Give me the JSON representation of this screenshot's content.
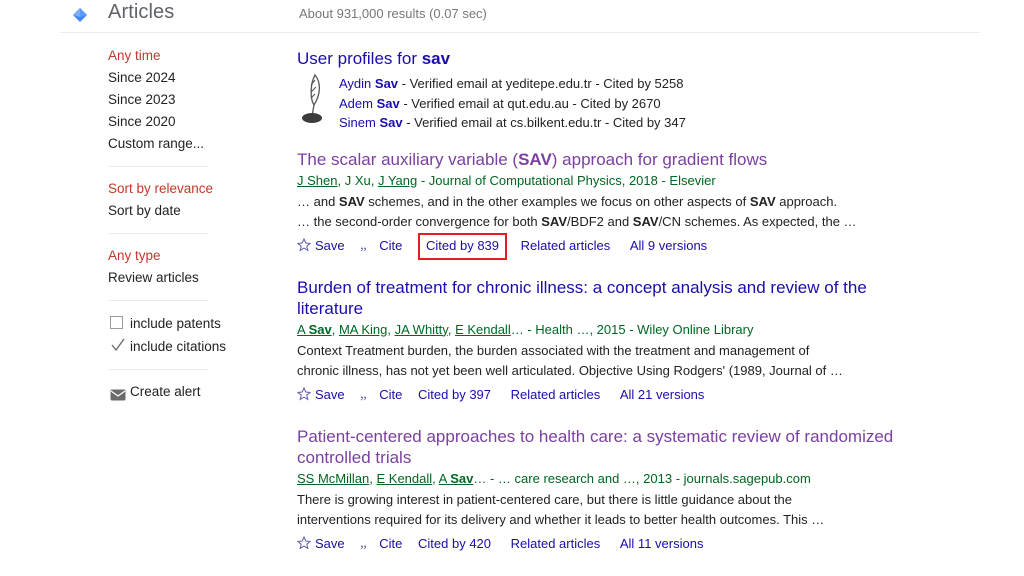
{
  "topbar": {
    "logo_icon": "scholar-diamond-icon",
    "title": "Articles",
    "results_count": "About 931,000 results (0.07 sec)"
  },
  "sidebar": {
    "time_filters": [
      {
        "label": "Any time",
        "selected": true
      },
      {
        "label": "Since 2024",
        "selected": false
      },
      {
        "label": "Since 2023",
        "selected": false
      },
      {
        "label": "Since 2020",
        "selected": false
      },
      {
        "label": "Custom range...",
        "selected": false
      }
    ],
    "sort_filters": [
      {
        "label": "Sort by relevance",
        "selected": true
      },
      {
        "label": "Sort by date",
        "selected": false
      }
    ],
    "type_filters": [
      {
        "label": "Any type",
        "selected": true
      },
      {
        "label": "Review articles",
        "selected": false
      }
    ],
    "checkboxes": [
      {
        "label": "include patents",
        "checked": false,
        "icon": "checkbox-empty-icon"
      },
      {
        "label": "include citations",
        "checked": true,
        "icon": "checkbox-checked-icon"
      }
    ],
    "alert": {
      "label": "Create alert",
      "icon": "envelope-icon"
    }
  },
  "profiles": {
    "heading_prefix": "User profiles for ",
    "heading_query": "sav",
    "icon": "quill-pen-icon",
    "entries": [
      {
        "first_name": "Aydin ",
        "last_name": "Sav",
        "detail": " - Verified email at yeditepe.edu.tr - Cited by 5258"
      },
      {
        "first_name": "Adem ",
        "last_name": "Sav",
        "detail": " - Verified email at qut.edu.au - Cited by 2670"
      },
      {
        "first_name": "Sinem ",
        "last_name": "Sav",
        "detail": " - Verified email at cs.bilkent.edu.tr - Cited by 347"
      }
    ]
  },
  "results": [
    {
      "title_pre": "The scalar auxiliary variable (",
      "title_bold": "SAV",
      "title_post": ") approach for gradient flows",
      "visited": true,
      "authors": [
        {
          "text": "J Shen",
          "link": true
        },
        {
          "text": ", ",
          "link": false
        },
        {
          "text": "J Xu",
          "link": false
        },
        {
          "text": ", ",
          "link": false
        },
        {
          "text": "J Yang",
          "link": true
        }
      ],
      "meta_tail": " - Journal of Computational Physics, 2018 - Elsevier",
      "snippet_line1_a": "… and ",
      "snippet_line1_b": "SAV",
      "snippet_line1_c": " schemes, and in the other examples we focus on other aspects of ",
      "snippet_line1_d": "SAV",
      "snippet_line1_e": " approach.",
      "snippet_line2_a": "… the second-order convergence for both ",
      "snippet_line2_b": "SAV",
      "snippet_line2_c": "/BDF2 and ",
      "snippet_line2_d": "SAV",
      "snippet_line2_e": "/CN schemes. As expected, the …",
      "actions": {
        "save": "Save",
        "cite": "Cite",
        "cited_by": "Cited by 839",
        "related": "Related articles",
        "versions": "All 9 versions"
      },
      "cited_by_highlighted": true,
      "highlight_color": "#e02020"
    },
    {
      "title_pre": "Burden of treatment for chronic illness: a concept analysis and review of the literature",
      "title_bold": "",
      "title_post": "",
      "visited": false,
      "authors": [
        {
          "text": "A Sav",
          "link": true,
          "bold_part": "Sav"
        },
        {
          "text": ", ",
          "link": false
        },
        {
          "text": "MA King",
          "link": true
        },
        {
          "text": ", ",
          "link": false
        },
        {
          "text": "JA Whitty",
          "link": true
        },
        {
          "text": ", ",
          "link": false
        },
        {
          "text": "E Kendall",
          "link": true
        }
      ],
      "meta_tail": "… - Health …, 2015 - Wiley Online Library",
      "snippet_line1_a": "Context Treatment burden, the burden associated with the treatment and management of",
      "snippet_line1_b": "",
      "snippet_line1_c": "",
      "snippet_line1_d": "",
      "snippet_line1_e": "",
      "snippet_line2_a": "chronic illness, has not yet been well articulated. Objective Using Rodgers' (1989, Journal of …",
      "snippet_line2_b": "",
      "snippet_line2_c": "",
      "snippet_line2_d": "",
      "snippet_line2_e": "",
      "actions": {
        "save": "Save",
        "cite": "Cite",
        "cited_by": "Cited by 397",
        "related": "Related articles",
        "versions": "All 21 versions"
      },
      "cited_by_highlighted": false,
      "highlight_color": ""
    },
    {
      "title_pre": "Patient-centered approaches to health care: a systematic review of randomized controlled trials",
      "title_bold": "",
      "title_post": "",
      "visited": true,
      "authors": [
        {
          "text": "SS McMillan",
          "link": true
        },
        {
          "text": ", ",
          "link": false
        },
        {
          "text": "E Kendall",
          "link": true
        },
        {
          "text": ", ",
          "link": false
        },
        {
          "text": "A Sav",
          "link": true,
          "bold_part": "Sav"
        }
      ],
      "meta_tail": "… - … care research and …, 2013 - journals.sagepub.com",
      "snippet_line1_a": "There is growing interest in patient-centered care, but there is little guidance about the",
      "snippet_line1_b": "",
      "snippet_line1_c": "",
      "snippet_line1_d": "",
      "snippet_line1_e": "",
      "snippet_line2_a": "interventions required for its delivery and whether it leads to better health outcomes. This …",
      "snippet_line2_b": "",
      "snippet_line2_c": "",
      "snippet_line2_d": "",
      "snippet_line2_e": "",
      "actions": {
        "save": "Save",
        "cite": "Cite",
        "cited_by": "Cited by 420",
        "related": "Related articles",
        "versions": "All 11 versions"
      },
      "cited_by_highlighted": false,
      "highlight_color": ""
    }
  ],
  "colors": {
    "link": "#1a0dab",
    "visited_link": "#7b3fa0",
    "meta_green": "#006621",
    "filter_active": "#c0392b",
    "highlight_red": "#e02020"
  }
}
